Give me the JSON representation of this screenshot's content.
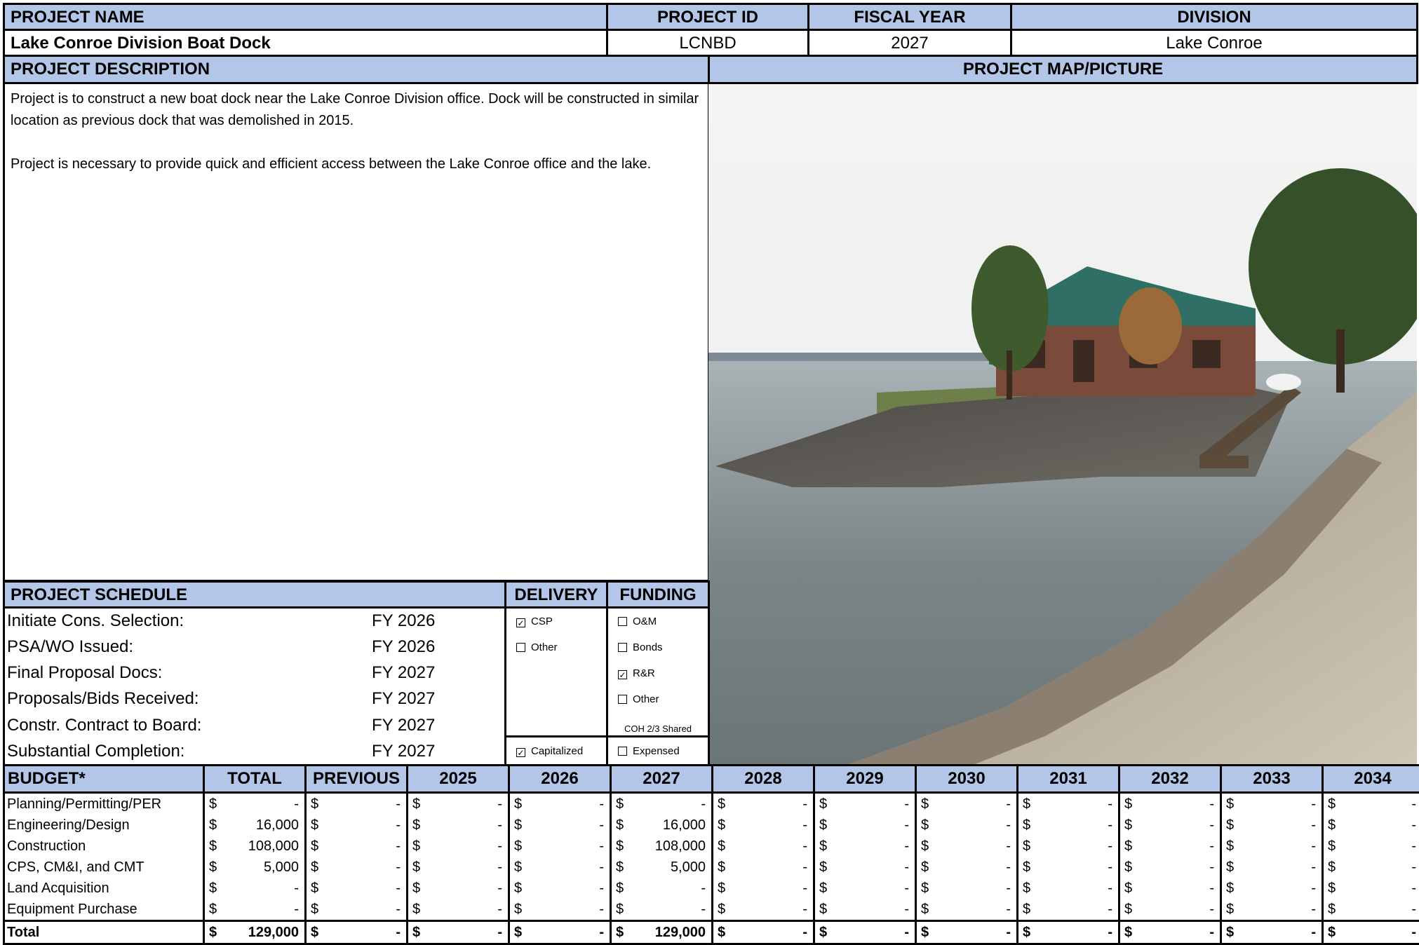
{
  "header": {
    "project_name_label": "PROJECT NAME",
    "project_id_label": "PROJECT ID",
    "fiscal_year_label": "FISCAL YEAR",
    "division_label": "DIVISION",
    "project_name": "Lake Conroe Division Boat Dock",
    "project_id": "LCNBD",
    "fiscal_year": "2027",
    "division": "Lake Conroe"
  },
  "description": {
    "label": "PROJECT DESCRIPTION",
    "para1": "Project is to construct a new boat dock near the Lake Conroe Division office.  Dock will be constructed in similar location as previous dock that was demolished in 2015.",
    "para2": "Project is necessary to provide quick and efficient access between the Lake Conroe office and the lake."
  },
  "map": {
    "label": "PROJECT MAP/PICTURE"
  },
  "schedule": {
    "label": "PROJECT SCHEDULE",
    "delivery_label": "DELIVERY",
    "funding_label": "FUNDING",
    "rows": [
      {
        "task": "Initiate Cons. Selection:",
        "fy": "FY 2026"
      },
      {
        "task": "PSA/WO Issued:",
        "fy": "FY 2026"
      },
      {
        "task": "Final Proposal Docs:",
        "fy": "FY 2027"
      },
      {
        "task": "Proposals/Bids Received:",
        "fy": "FY 2027"
      },
      {
        "task": "Constr. Contract to Board:",
        "fy": "FY 2027"
      },
      {
        "task": "Substantial Completion:",
        "fy": "FY 2027"
      }
    ],
    "delivery": [
      {
        "label": "CSP",
        "checked": true
      },
      {
        "label": "Other",
        "checked": false
      }
    ],
    "funding": [
      {
        "label": "O&M",
        "checked": false
      },
      {
        "label": "Bonds",
        "checked": false
      },
      {
        "label": "R&R",
        "checked": true
      },
      {
        "label": "Other",
        "checked": false
      }
    ],
    "shared_note": "COH 2/3 Shared",
    "capitalized": {
      "label": "Capitalized",
      "checked": true
    },
    "expensed": {
      "label": "Expensed",
      "checked": false
    }
  },
  "budget": {
    "headers": [
      "BUDGET*",
      "TOTAL",
      "PREVIOUS",
      "2025",
      "2026",
      "2027",
      "2028",
      "2029",
      "2030",
      "2031",
      "2032",
      "2033",
      "2034"
    ],
    "rows": [
      {
        "label": "Planning/Permitting/PER",
        "values": [
          "-",
          "-",
          "-",
          "-",
          "-",
          "-",
          "-",
          "-",
          "-",
          "-",
          "-",
          "-"
        ]
      },
      {
        "label": "Engineering/Design",
        "values": [
          "16,000",
          "-",
          "-",
          "-",
          "16,000",
          "-",
          "-",
          "-",
          "-",
          "-",
          "-",
          "-"
        ]
      },
      {
        "label": "Construction",
        "values": [
          "108,000",
          "-",
          "-",
          "-",
          "108,000",
          "-",
          "-",
          "-",
          "-",
          "-",
          "-",
          "-"
        ]
      },
      {
        "label": "CPS, CM&I, and CMT",
        "values": [
          "5,000",
          "-",
          "-",
          "-",
          "5,000",
          "-",
          "-",
          "-",
          "-",
          "-",
          "-",
          "-"
        ]
      },
      {
        "label": "Land Acquisition",
        "values": [
          "-",
          "-",
          "-",
          "-",
          "-",
          "-",
          "-",
          "-",
          "-",
          "-",
          "-",
          "-"
        ]
      },
      {
        "label": "Equipment Purchase",
        "values": [
          "-",
          "-",
          "-",
          "-",
          "-",
          "-",
          "-",
          "-",
          "-",
          "-",
          "-",
          "-"
        ]
      }
    ],
    "total": {
      "label": "Total",
      "values": [
        "129,000",
        "-",
        "-",
        "-",
        "129,000",
        "-",
        "-",
        "-",
        "-",
        "-",
        "-",
        "-"
      ]
    },
    "currency": "$"
  }
}
